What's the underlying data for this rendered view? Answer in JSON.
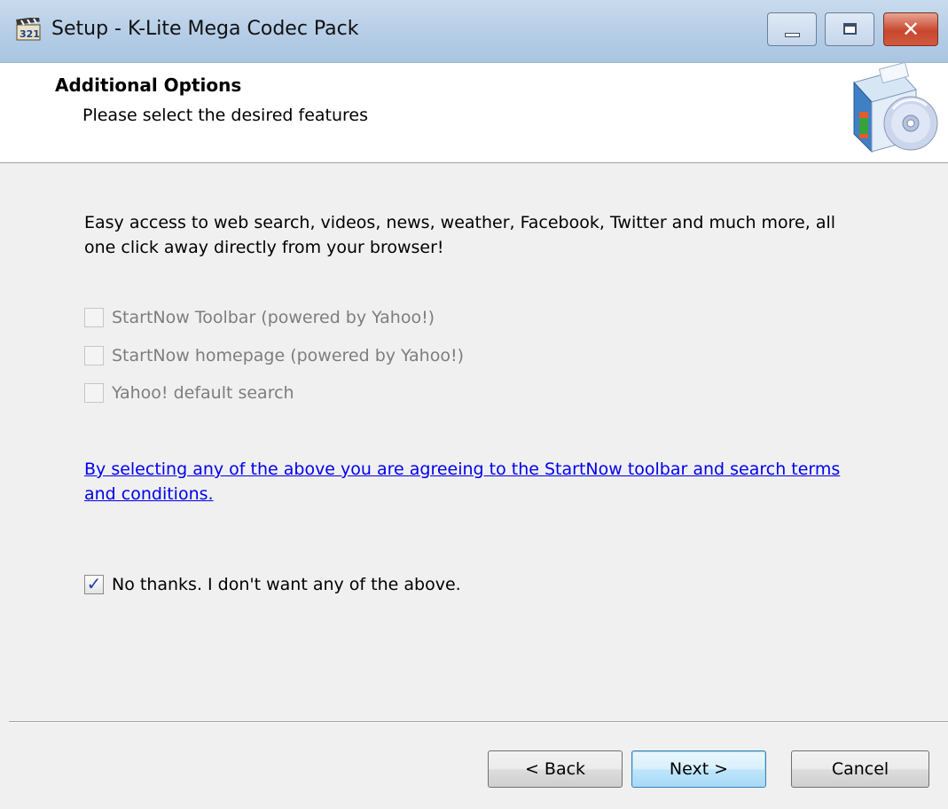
{
  "window": {
    "title": "Setup - K-Lite Mega Codec Pack",
    "controls": {
      "minimize": "minimize",
      "maximize": "maximize",
      "close": "✕"
    },
    "colors": {
      "title_bar": "#b5cde6",
      "close_button": "#c7472e",
      "link": "#0000ee"
    }
  },
  "header": {
    "title": "Additional Options",
    "subtitle": "Please select the desired features"
  },
  "body": {
    "description": "Easy access to web search, videos, news, weather, Facebook, Twitter and much more, all one click away directly from your browser!",
    "options": [
      {
        "label": "StartNow Toolbar (powered by Yahoo!)",
        "checked": false,
        "enabled": false
      },
      {
        "label": "StartNow homepage (powered by Yahoo!)",
        "checked": false,
        "enabled": false
      },
      {
        "label": "Yahoo! default search",
        "checked": false,
        "enabled": false
      }
    ],
    "terms_link": "By selecting any of the above you are agreeing to the StartNow toolbar and search terms and conditions.",
    "decline_option": {
      "label": "No thanks. I don't want any of the above.",
      "checked": true,
      "enabled": true
    },
    "check_mark": "✓"
  },
  "buttons": {
    "back": "< Back",
    "next": "Next >",
    "cancel": "Cancel"
  },
  "icons": {
    "app": "video-clapper-icon",
    "header": "software-box-cd-icon"
  }
}
